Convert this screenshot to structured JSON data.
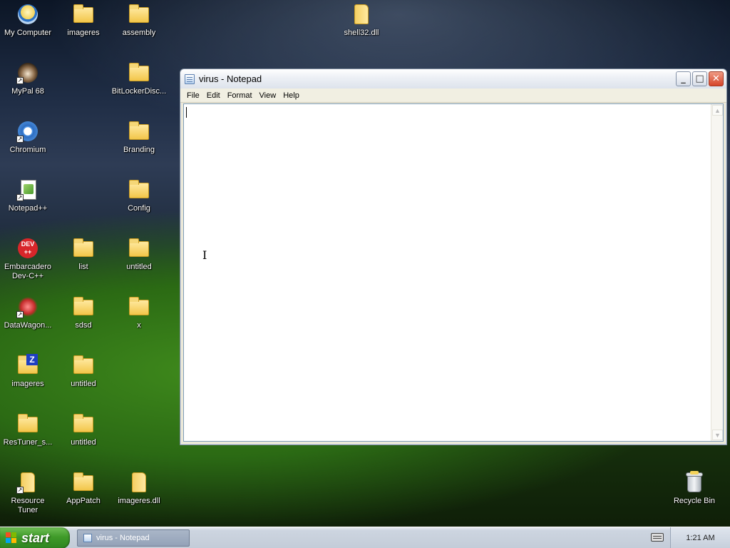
{
  "desktop": {
    "icons": [
      {
        "label": "My Computer"
      },
      {
        "label": "imageres"
      },
      {
        "label": "assembly"
      },
      {
        "label": "shell32.dll"
      },
      {
        "label": "MyPal 68"
      },
      {
        "label": "BitLockerDisc..."
      },
      {
        "label": "Chromium"
      },
      {
        "label": "Branding"
      },
      {
        "label": "Notepad++"
      },
      {
        "label": "Config"
      },
      {
        "label": "Embarcadero Dev-C++"
      },
      {
        "label": "list"
      },
      {
        "label": "untitled"
      },
      {
        "label": "DataWagon..."
      },
      {
        "label": "sdsd"
      },
      {
        "label": "x"
      },
      {
        "label": "imageres"
      },
      {
        "label": "untitled"
      },
      {
        "label": "ResTuner_s..."
      },
      {
        "label": "untitled"
      },
      {
        "label": "Resource Tuner"
      },
      {
        "label": "AppPatch"
      },
      {
        "label": "imageres.dll"
      },
      {
        "label": "Recycle Bin"
      }
    ],
    "devcpp_badge": "DEV\n++"
  },
  "notepad": {
    "title": "virus - Notepad",
    "menu": [
      "File",
      "Edit",
      "Format",
      "View",
      "Help"
    ],
    "content": ""
  },
  "taskbar": {
    "start_label": "start",
    "task_label": "virus - Notepad",
    "clock": "1:21 AM"
  },
  "colors": {
    "start_green": "#3f9a29",
    "close_red": "#d6452a",
    "folder_yellow": "#f2c64a"
  }
}
